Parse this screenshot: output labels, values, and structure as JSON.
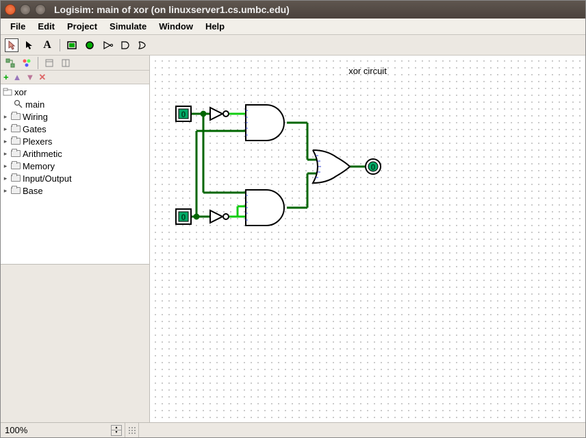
{
  "window": {
    "title": "Logisim: main of xor (on linuxserver1.cs.umbc.edu)"
  },
  "menu": [
    "File",
    "Edit",
    "Project",
    "Simulate",
    "Window",
    "Help"
  ],
  "tree": {
    "project": "xor",
    "main": "main",
    "folders": [
      "Wiring",
      "Gates",
      "Plexers",
      "Arithmetic",
      "Memory",
      "Input/Output",
      "Base"
    ]
  },
  "canvas": {
    "label": "xor circuit",
    "inA": "0",
    "inB": "0",
    "out": "0"
  },
  "zoom": "100%"
}
